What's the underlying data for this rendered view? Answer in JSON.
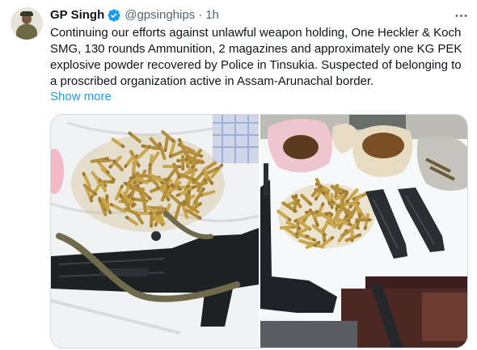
{
  "author": {
    "name": "GP Singh",
    "handle": "@gpsinghips",
    "time": "1h"
  },
  "tweet": {
    "text": "Continuing our efforts against unlawful weapon holding, One Heckler & Koch SMG, 130 rounds Ammunition, 2 magazines and approximately one KG PEK explosive powder recovered by Police in Tinsukia. Suspected of belonging to a proscribed organization active in Assam-Arunachal border.",
    "show_more_label": "Show more"
  },
  "icons": {
    "verified": "verified-badge-icon",
    "more": "more-options-icon"
  },
  "colors": {
    "link": "#1d9bf0",
    "secondary_text": "#536471",
    "verified": "#1d9bf0"
  }
}
